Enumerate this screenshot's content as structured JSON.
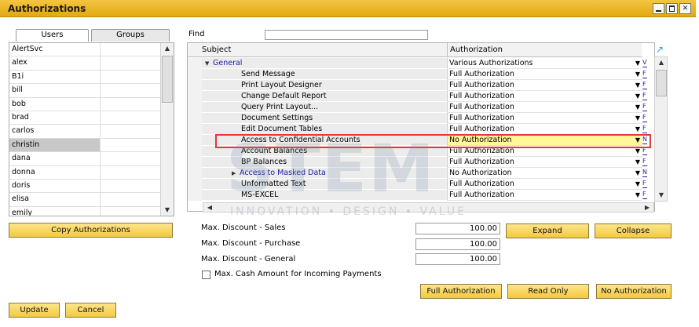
{
  "window": {
    "title": "Authorizations"
  },
  "tabs": {
    "users": "Users",
    "groups": "Groups"
  },
  "users": [
    "AlertSvc",
    "alex",
    "B1i",
    "bill",
    "bob",
    "brad",
    "carlos",
    "christin",
    "dana",
    "donna",
    "doris",
    "elisa",
    "emily"
  ],
  "selected_user": "christin",
  "copy_button": "Copy Authorizations",
  "find": {
    "label": "Find",
    "value": ""
  },
  "grid": {
    "columns": {
      "subject": "Subject",
      "authorization": "Authorization"
    },
    "rows": [
      {
        "subject": "General",
        "auth": "Various Authorizations",
        "type": "group"
      },
      {
        "subject": "Send Message",
        "auth": "Full Authorization",
        "type": "item"
      },
      {
        "subject": "Print Layout Designer",
        "auth": "Full Authorization",
        "type": "item"
      },
      {
        "subject": "Change Default Report",
        "auth": "Full Authorization",
        "type": "item"
      },
      {
        "subject": "Query Print Layout...",
        "auth": "Full Authorization",
        "type": "item"
      },
      {
        "subject": "Document Settings",
        "auth": "Full Authorization",
        "type": "item"
      },
      {
        "subject": "Edit Document Tables",
        "auth": "Full Authorization",
        "type": "item"
      },
      {
        "subject": "Access to Confidential Accounts",
        "auth": "No Authorization",
        "type": "item",
        "highlight": true
      },
      {
        "subject": "Account Balances",
        "auth": "Full Authorization",
        "type": "item"
      },
      {
        "subject": "BP Balances",
        "auth": "Full Authorization",
        "type": "item"
      },
      {
        "subject": "Access to Masked Data",
        "auth": "No Authorization",
        "type": "subgroup"
      },
      {
        "subject": "Unformatted Text",
        "auth": "Full Authorization",
        "type": "item"
      },
      {
        "subject": "MS-EXCEL",
        "auth": "Full Authorization",
        "type": "item"
      }
    ]
  },
  "watermark": {
    "main": "STEM",
    "sub": "INNOVATION • DESIGN • VALUE"
  },
  "fields": {
    "max_discount_sales": {
      "label": "Max. Discount - Sales",
      "value": "100.00"
    },
    "max_discount_purchase": {
      "label": "Max. Discount - Purchase",
      "value": "100.00"
    },
    "max_discount_general": {
      "label": "Max. Discount - General",
      "value": "100.00"
    },
    "max_cash": {
      "label": "Max. Cash Amount for Incoming Payments",
      "checked": false
    }
  },
  "buttons": {
    "expand": "Expand",
    "collapse": "Collapse",
    "full_authorization": "Full Authorization",
    "read_only": "Read Only",
    "no_authorization": "No Authorization",
    "update": "Update",
    "cancel": "Cancel"
  },
  "colors": {
    "title_bar": "#f4c542",
    "button": "#f4c93f",
    "highlight_cell": "#fff79a",
    "highlight_border": "#e53935",
    "link": "#1a1aa8"
  }
}
